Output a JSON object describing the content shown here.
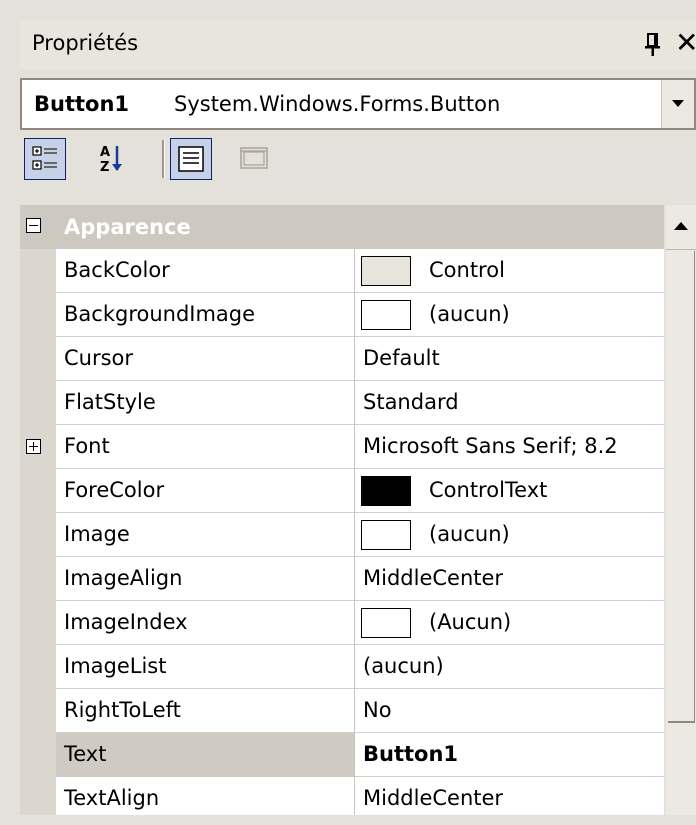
{
  "panel": {
    "title": "Propriétés"
  },
  "object_selector": {
    "name": "Button1",
    "type": "System.Windows.Forms.Button"
  },
  "toolbar": {
    "buttons": [
      {
        "icon": "categorized-icon",
        "pressed": true
      },
      {
        "icon": "alphabetical-sort-icon",
        "pressed": false
      },
      {
        "icon": "properties-icon",
        "pressed": true
      },
      {
        "icon": "property-pages-icon",
        "pressed": false,
        "disabled": true
      }
    ]
  },
  "category": {
    "label": "Apparence",
    "expanded": true
  },
  "properties": [
    {
      "name": "BackColor",
      "value": "Control",
      "swatch": "#e7e4dc"
    },
    {
      "name": "BackgroundImage",
      "value": "(aucun)",
      "swatch": "#ffffff"
    },
    {
      "name": "Cursor",
      "value": "Default"
    },
    {
      "name": "FlatStyle",
      "value": "Standard"
    },
    {
      "name": "Font",
      "value": "Microsoft Sans Serif; 8.2",
      "expandable": true
    },
    {
      "name": "ForeColor",
      "value": "ControlText",
      "swatch": "#000000"
    },
    {
      "name": "Image",
      "value": "(aucun)",
      "swatch": "#ffffff"
    },
    {
      "name": "ImageAlign",
      "value": "MiddleCenter"
    },
    {
      "name": "ImageIndex",
      "value": "(Aucun)",
      "swatch": "#ffffff"
    },
    {
      "name": "ImageList",
      "value": "(aucun)"
    },
    {
      "name": "RightToLeft",
      "value": "No"
    },
    {
      "name": "Text",
      "value": "Button1",
      "selected": true,
      "bold": true
    },
    {
      "name": "TextAlign",
      "value": "MiddleCenter"
    }
  ]
}
